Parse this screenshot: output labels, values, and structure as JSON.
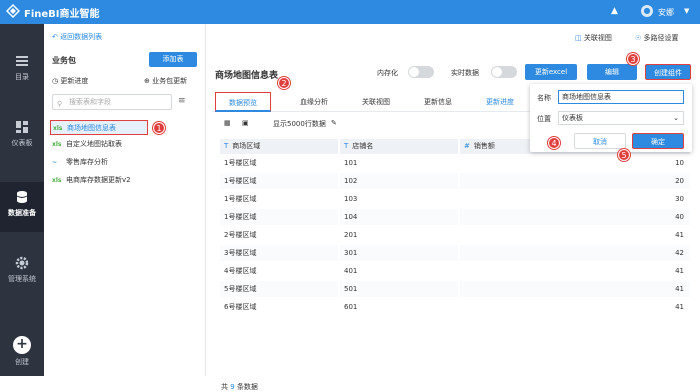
{
  "app": {
    "title": "FineBI商业智能",
    "user": "安娜"
  },
  "rail": [
    {
      "label": "目录"
    },
    {
      "label": "仪表板"
    },
    {
      "label": "数据准备"
    },
    {
      "label": "管理系统"
    },
    {
      "label": "创建"
    }
  ],
  "left": {
    "back": "返回数据列表",
    "biz": "业务包",
    "add": "添加表",
    "update_progress": "更新进度",
    "biz_update": "业务包更新",
    "search_placeholder": "搜索表和字段",
    "items": [
      {
        "tag": "xls",
        "label": "商场地图信息表"
      },
      {
        "tag": "xls",
        "label": "自定义地图钻取表"
      },
      {
        "tag": "~",
        "label": "零售库存分析"
      },
      {
        "tag": "xls",
        "label": "电商库存数据更新v2"
      }
    ]
  },
  "main": {
    "link1": "关联视图",
    "link2": "多路径设置",
    "table_name": "商场地图信息表",
    "memory": "内存化",
    "realtime": "实时数据",
    "btn_excel": "更新excel",
    "btn_edit": "编辑",
    "btn_create": "创建组件",
    "tabs": [
      "数据预览",
      "血缘分析",
      "关联视图",
      "更新信息",
      "更新进度"
    ],
    "show_rows": "显示5000行数据",
    "columns": [
      "商场区域",
      "店铺名",
      "销售额"
    ],
    "col_types": [
      "T",
      "T",
      "#"
    ],
    "rows": [
      [
        "1号楼区域",
        "101",
        "10"
      ],
      [
        "1号楼区域",
        "102",
        "20"
      ],
      [
        "1号楼区域",
        "103",
        "30"
      ],
      [
        "1号楼区域",
        "104",
        "40"
      ],
      [
        "2号楼区域",
        "201",
        "41"
      ],
      [
        "3号楼区域",
        "301",
        "42"
      ],
      [
        "4号楼区域",
        "401",
        "41"
      ],
      [
        "5号楼区域",
        "501",
        "41"
      ],
      [
        "6号楼区域",
        "601",
        "41"
      ]
    ],
    "total_prefix": "共",
    "total_n": "9",
    "total_suffix": "条数据"
  },
  "dialog": {
    "name_label": "名称",
    "name_value": "商场地图信息表",
    "pos_label": "位置",
    "pos_value": "仪表板",
    "cancel": "取消",
    "confirm": "确定"
  },
  "badges": [
    "1",
    "2",
    "3",
    "4",
    "5"
  ]
}
